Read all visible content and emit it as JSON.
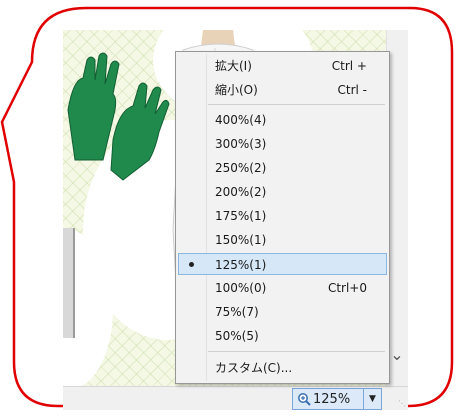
{
  "menu": {
    "zoom_in": {
      "label": "拡大(I)",
      "shortcut": "Ctrl +"
    },
    "zoom_out": {
      "label": "縮小(O)",
      "shortcut": "Ctrl -"
    },
    "levels": [
      {
        "label": "400%(4)",
        "shortcut": "",
        "selected": false
      },
      {
        "label": "300%(3)",
        "shortcut": "",
        "selected": false
      },
      {
        "label": "250%(2)",
        "shortcut": "",
        "selected": false
      },
      {
        "label": "200%(2)",
        "shortcut": "",
        "selected": false
      },
      {
        "label": "175%(1)",
        "shortcut": "",
        "selected": false
      },
      {
        "label": "150%(1)",
        "shortcut": "",
        "selected": false
      },
      {
        "label": "125%(1)",
        "shortcut": "",
        "selected": true
      },
      {
        "label": "100%(0)",
        "shortcut": "Ctrl+0",
        "selected": false
      },
      {
        "label": "75%(7)",
        "shortcut": "",
        "selected": false
      },
      {
        "label": "50%(5)",
        "shortcut": "",
        "selected": false
      }
    ],
    "custom": {
      "label": "カスタム(C)..."
    }
  },
  "statusbar": {
    "zoom_value": "125%",
    "zoom_icon": "magnifier-icon",
    "dropdown_icon": "triangle-down-icon"
  },
  "colors": {
    "callout_border": "#e00000",
    "menu_bg": "#f2f2f2",
    "selected_bg": "#d6e8f8",
    "selected_border": "#8ab6e0",
    "glove_green": "#1f8a4c"
  }
}
